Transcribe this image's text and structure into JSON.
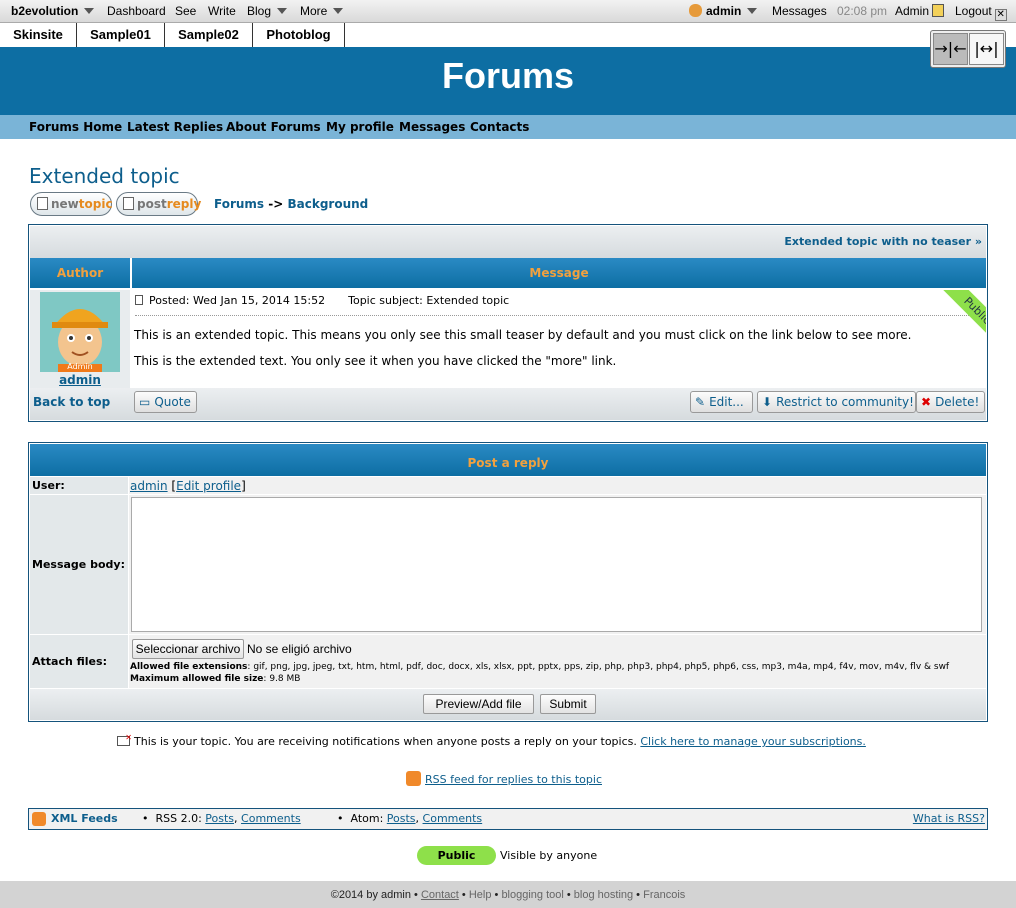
{
  "adminbar": {
    "brand": "b2evolution",
    "items": [
      "Dashboard",
      "See",
      "Write",
      "Blog",
      "More"
    ],
    "user": "admin",
    "messages": "Messages",
    "time": "02:08 pm",
    "admin": "Admin",
    "logout": "Logout"
  },
  "sitetabs": [
    "Skinsite",
    "Sample01",
    "Sample02",
    "Photoblog"
  ],
  "header": {
    "title": "Forums"
  },
  "nav": [
    "Forums Home",
    "Latest Replies",
    "About Forums",
    "My profile",
    "Messages",
    "Contacts"
  ],
  "page": {
    "title": "Extended topic",
    "new_topic": {
      "a": "new",
      "b": "topic"
    },
    "post_reply": {
      "a": "post",
      "b": "reply"
    },
    "crumb_forums": "Forums",
    "crumb_sep": "->",
    "crumb_background": "Background"
  },
  "topic": {
    "next_link": "Extended topic with no teaser »",
    "col_author": "Author",
    "col_message": "Message",
    "avatar_caption": "Admin",
    "author": "admin",
    "posted_label": "Posted:",
    "posted_date": "Wed Jan 15, 2014 15:52",
    "subject_label": "Topic subject:",
    "subject": "Extended topic",
    "ribbon": "Public",
    "paragraph1": "This is an extended topic. This means you only see this small teaser by default and you must click on the link below to see more.",
    "paragraph2": "This is the extended text. You only see it when you have clicked the \"more\" link.",
    "back_to_top": "Back to top",
    "quote": "Quote",
    "edit": "Edit...",
    "restrict": "Restrict to community!",
    "delete": "Delete!"
  },
  "reply": {
    "heading": "Post a reply",
    "user_label": "User:",
    "user": "admin",
    "edit_profile": "Edit profile",
    "body_label": "Message body:",
    "attach_label": "Attach files:",
    "file_button": "Seleccionar archivo",
    "file_none": "No se eligió archivo",
    "allowed_label": "Allowed file extensions",
    "allowed_value": ": gif, png, jpg, jpeg, txt, htm, html, pdf, doc, docx, xls, xlsx, ppt, pptx, pps, zip, php, php3, php4, php5, php6, css, mp3, m4a, mp4, f4v, mov, m4v, flv & swf",
    "maxsize_label": "Maximum allowed file size",
    "maxsize_value": ": 9.8 MB",
    "preview": "Preview/Add file",
    "submit": "Submit"
  },
  "notify": {
    "text": "This is your topic. You are receiving notifications when anyone posts a reply on your topics.",
    "link": "Click here to manage your subscriptions."
  },
  "rss_replies": "RSS feed for replies to this topic",
  "feeds": {
    "title": "XML Feeds",
    "rss_label": "RSS 2.0:",
    "atom_label": "Atom:",
    "posts": "Posts",
    "comments": "Comments",
    "what": "What is RSS?"
  },
  "visibility": {
    "badge": "Public",
    "text": "Visible by anyone"
  },
  "footer": {
    "copyright": "©2014 by admin",
    "contact": "Contact",
    "help": "Help",
    "blogging_tool": "blogging tool",
    "blog_hosting": "blog hosting",
    "francois": "Francois"
  },
  "colors": {
    "header_blue": "#0d6ea3",
    "nav_blue": "#7ab4d7",
    "link": "#0d5e8c",
    "accent_orange": "#f1a13e",
    "public_green": "#8ee04a"
  }
}
